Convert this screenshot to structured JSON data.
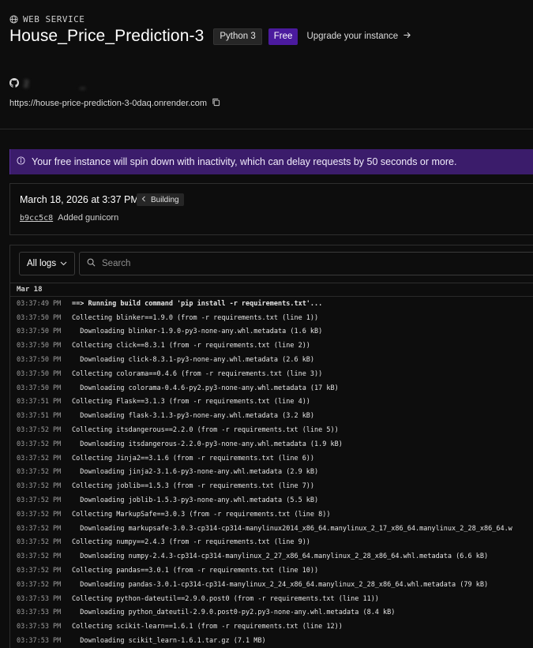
{
  "service": {
    "type_label": "WEB SERVICE",
    "name": "House_Price_Prediction-3",
    "runtime": "Python 3",
    "plan": "Free",
    "upgrade_label": "Upgrade your instance",
    "repo_text": "2          _",
    "url": "https://house-price-prediction-3-0daq.onrender.com"
  },
  "banner": {
    "text": "Your free instance will spin down with inactivity, which can delay requests by 50 seconds or more."
  },
  "deploy": {
    "date": "March 18, 2026 at 3:37 PM",
    "status": "Building",
    "commit_sha": "b9cc5c8",
    "commit_message": "Added gunicorn"
  },
  "logs": {
    "filter_label": "All logs",
    "search_placeholder": "Search",
    "date_header": "Mar 18",
    "lines": [
      {
        "ts": "03:37:49 PM",
        "msg": "==> Running build command 'pip install -r requirements.txt'...",
        "bold": true
      },
      {
        "ts": "03:37:50 PM",
        "msg": "Collecting blinker==1.9.0 (from -r requirements.txt (line 1))",
        "bold": false
      },
      {
        "ts": "03:37:50 PM",
        "msg": "  Downloading blinker-1.9.0-py3-none-any.whl.metadata (1.6 kB)",
        "bold": false
      },
      {
        "ts": "03:37:50 PM",
        "msg": "Collecting click==8.3.1 (from -r requirements.txt (line 2))",
        "bold": false
      },
      {
        "ts": "03:37:50 PM",
        "msg": "  Downloading click-8.3.1-py3-none-any.whl.metadata (2.6 kB)",
        "bold": false
      },
      {
        "ts": "03:37:50 PM",
        "msg": "Collecting colorama==0.4.6 (from -r requirements.txt (line 3))",
        "bold": false
      },
      {
        "ts": "03:37:50 PM",
        "msg": "  Downloading colorama-0.4.6-py2.py3-none-any.whl.metadata (17 kB)",
        "bold": false
      },
      {
        "ts": "03:37:51 PM",
        "msg": "Collecting Flask==3.1.3 (from -r requirements.txt (line 4))",
        "bold": false
      },
      {
        "ts": "03:37:51 PM",
        "msg": "  Downloading flask-3.1.3-py3-none-any.whl.metadata (3.2 kB)",
        "bold": false
      },
      {
        "ts": "03:37:52 PM",
        "msg": "Collecting itsdangerous==2.2.0 (from -r requirements.txt (line 5))",
        "bold": false
      },
      {
        "ts": "03:37:52 PM",
        "msg": "  Downloading itsdangerous-2.2.0-py3-none-any.whl.metadata (1.9 kB)",
        "bold": false
      },
      {
        "ts": "03:37:52 PM",
        "msg": "Collecting Jinja2==3.1.6 (from -r requirements.txt (line 6))",
        "bold": false
      },
      {
        "ts": "03:37:52 PM",
        "msg": "  Downloading jinja2-3.1.6-py3-none-any.whl.metadata (2.9 kB)",
        "bold": false
      },
      {
        "ts": "03:37:52 PM",
        "msg": "Collecting joblib==1.5.3 (from -r requirements.txt (line 7))",
        "bold": false
      },
      {
        "ts": "03:37:52 PM",
        "msg": "  Downloading joblib-1.5.3-py3-none-any.whl.metadata (5.5 kB)",
        "bold": false
      },
      {
        "ts": "03:37:52 PM",
        "msg": "Collecting MarkupSafe==3.0.3 (from -r requirements.txt (line 8))",
        "bold": false
      },
      {
        "ts": "03:37:52 PM",
        "msg": "  Downloading markupsafe-3.0.3-cp314-cp314-manylinux2014_x86_64.manylinux_2_17_x86_64.manylinux_2_28_x86_64.w",
        "bold": false
      },
      {
        "ts": "03:37:52 PM",
        "msg": "Collecting numpy==2.4.3 (from -r requirements.txt (line 9))",
        "bold": false
      },
      {
        "ts": "03:37:52 PM",
        "msg": "  Downloading numpy-2.4.3-cp314-cp314-manylinux_2_27_x86_64.manylinux_2_28_x86_64.whl.metadata (6.6 kB)",
        "bold": false
      },
      {
        "ts": "03:37:52 PM",
        "msg": "Collecting pandas==3.0.1 (from -r requirements.txt (line 10))",
        "bold": false
      },
      {
        "ts": "03:37:52 PM",
        "msg": "  Downloading pandas-3.0.1-cp314-cp314-manylinux_2_24_x86_64.manylinux_2_28_x86_64.whl.metadata (79 kB)",
        "bold": false
      },
      {
        "ts": "03:37:53 PM",
        "msg": "Collecting python-dateutil==2.9.0.post0 (from -r requirements.txt (line 11))",
        "bold": false
      },
      {
        "ts": "03:37:53 PM",
        "msg": "  Downloading python_dateutil-2.9.0.post0-py2.py3-none-any.whl.metadata (8.4 kB)",
        "bold": false
      },
      {
        "ts": "03:37:53 PM",
        "msg": "Collecting scikit-learn==1.6.1 (from -r requirements.txt (line 12))",
        "bold": false
      },
      {
        "ts": "03:37:53 PM",
        "msg": "  Downloading scikit_learn-1.6.1.tar.gz (7.1 MB)",
        "bold": false
      }
    ]
  },
  "colors": {
    "background": "#0d0d0d",
    "plan_badge": "#4b1a9e",
    "banner": "#3b1c6b"
  },
  "icons": [
    "globe-icon",
    "arrow-right-icon",
    "github-icon",
    "copy-icon",
    "info-icon",
    "chevron-left-icon",
    "chevron-down-icon",
    "search-icon"
  ]
}
